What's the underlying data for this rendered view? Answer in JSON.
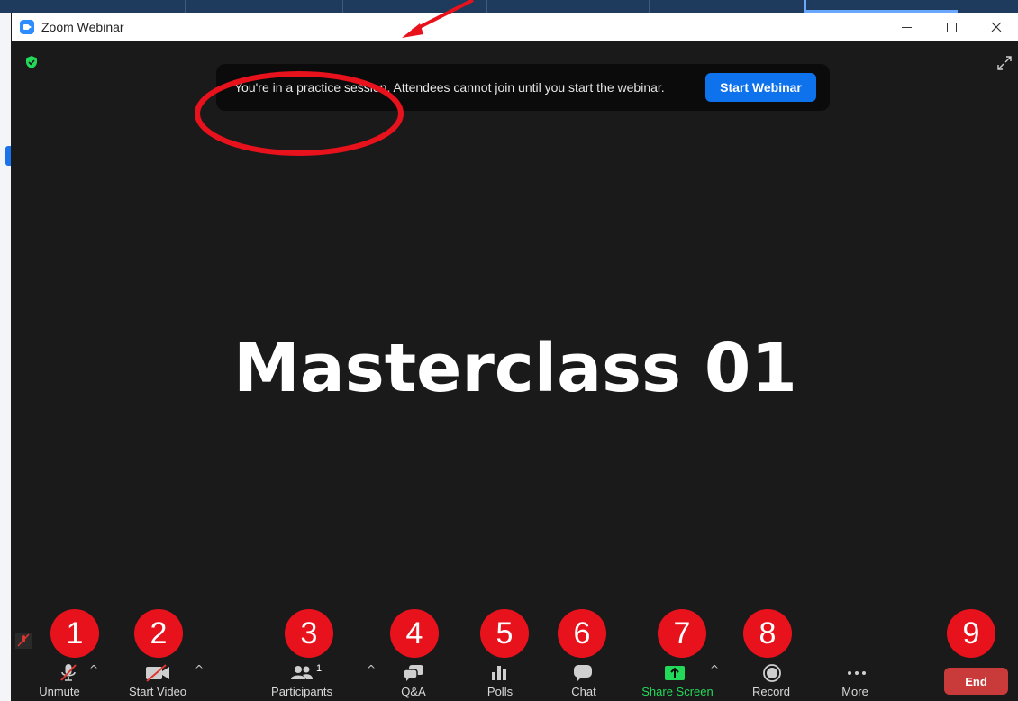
{
  "window": {
    "title": "Zoom Webinar"
  },
  "banner": {
    "message": "You're in a practice session. Attendees cannot join until you start the webinar.",
    "button_label": "Start Webinar"
  },
  "meeting": {
    "name": "Masterclass 01"
  },
  "toolbar": {
    "unmute": "Unmute",
    "start_video": "Start Video",
    "participants": "Participants",
    "participants_count": "1",
    "qa": "Q&A",
    "polls": "Polls",
    "chat": "Chat",
    "share_screen": "Share Screen",
    "record": "Record",
    "more": "More",
    "end": "End"
  },
  "badges": [
    "1",
    "2",
    "3",
    "4",
    "5",
    "6",
    "7",
    "8",
    "9"
  ],
  "colors": {
    "accent": "#0e72ed",
    "share_green": "#23d959",
    "end_red": "#c93a3a",
    "badge_red": "#e8121c",
    "annotation_red": "#e8121c",
    "background": "#1a1a1a"
  },
  "icons": [
    "app-icon",
    "shield-icon",
    "fullscreen-icon",
    "mic-off-icon",
    "video-off-icon",
    "participants-icon",
    "qa-icon",
    "polls-icon",
    "chat-icon",
    "share-screen-icon",
    "record-icon",
    "more-icon",
    "chevron-up-icon"
  ]
}
